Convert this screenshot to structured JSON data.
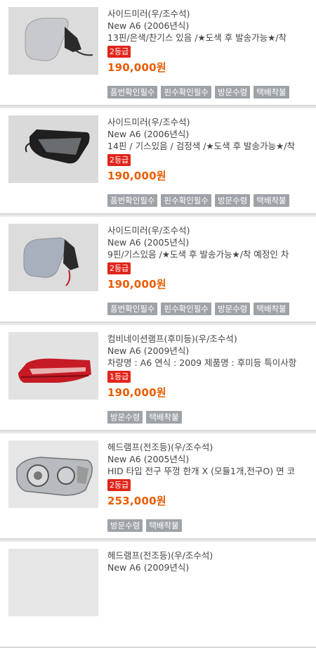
{
  "items": [
    {
      "title": "사이드미러(우/조수석)",
      "model": "New A6  (2006년식)",
      "desc": "13핀/은색/찬기스 있음 /★도색 후 발송가능★/착",
      "grade": "2등급",
      "price": "190,000원",
      "tags": [
        "품번확인필수",
        "핀수확인필수",
        "방문수령",
        "택배착불"
      ],
      "image": "silver-side-mirror"
    },
    {
      "title": "사이드미러(우/조수석)",
      "model": "New A6  (2006년식)",
      "desc": "14핀 / 기스있음 / 검정색 /★도색 후 발송가능★/착",
      "grade": "2등급",
      "price": "190,000원",
      "tags": [
        "품번확인필수",
        "핀수확인필수",
        "방문수령",
        "택배착불"
      ],
      "image": "black-side-mirror"
    },
    {
      "title": "사이드미러(우/조수석)",
      "model": "New A6  (2005년식)",
      "desc": "9핀/기스있음 /★도색 후 발송가능★/착 예정인 차",
      "grade": "2등급",
      "price": "190,000원",
      "tags": [
        "품번확인필수",
        "핀수확인필수",
        "방문수령",
        "택배착불"
      ],
      "image": "silver-side-mirror"
    },
    {
      "title": "컴비네이션램프(후미등)(우/조수석)",
      "model": "New A6  (2009년식)",
      "desc": "차량명 : A6 연식 : 2009 제품명 : 후미등 특이사항",
      "grade": "1등급",
      "price": "190,000원",
      "tags": [
        "방문수령",
        "택배착불"
      ],
      "image": "tail-lamp"
    },
    {
      "title": "헤드램프(전조등)(우/조수석)",
      "model": "New A6  (2005년식)",
      "desc": "HID 타입 전구 뚜껑 한개 X (모듈1개,전구O) 면 코",
      "grade": "2등급",
      "price": "253,000원",
      "tags": [
        "방문수령",
        "택배착불"
      ],
      "image": "head-lamp"
    },
    {
      "title": "헤드램프(전조등)(우/조수석)",
      "model": "New A6  (2009년식)",
      "desc": "",
      "grade": "",
      "price": "",
      "tags": [],
      "image": "head-lamp"
    }
  ]
}
